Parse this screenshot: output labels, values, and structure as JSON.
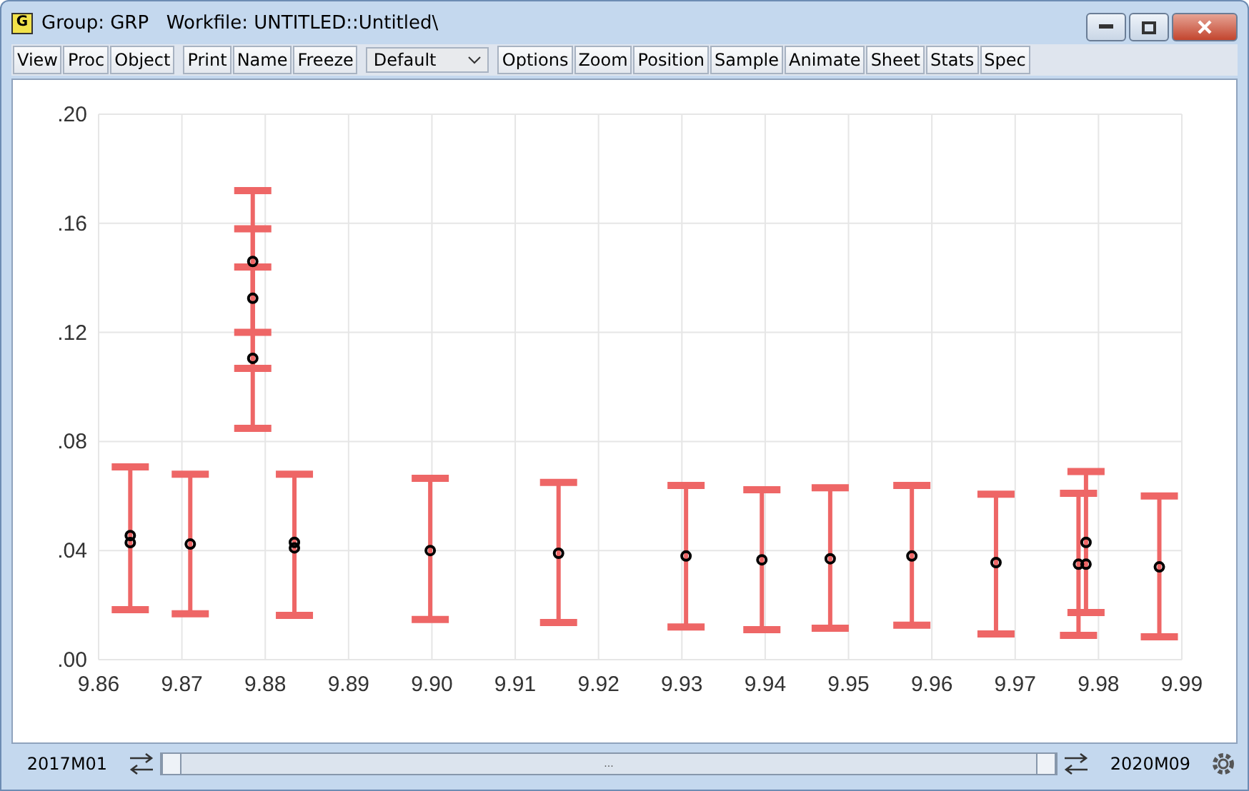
{
  "window": {
    "title": "Group: GRP   Workfile: UNTITLED::Untitled\\",
    "icon": "G"
  },
  "toolbar": {
    "groups": [
      [
        "View",
        "Proc",
        "Object"
      ],
      [
        "Print",
        "Name",
        "Freeze"
      ]
    ],
    "dropdown": {
      "value": "Default"
    },
    "more": [
      "Options",
      "Zoom",
      "Position",
      "Sample",
      "Animate",
      "Sheet",
      "Stats",
      "Spec"
    ]
  },
  "chart": {
    "chart_data": {
      "type": "scatter",
      "grid": true,
      "x": [
        9.8638,
        9.8638,
        9.871,
        9.8785,
        9.8785,
        9.8785,
        9.8835,
        9.8835,
        9.8998,
        9.9152,
        9.9305,
        9.9396,
        9.9478,
        9.9576,
        9.9677,
        9.9776,
        9.9785,
        9.9785,
        9.9873
      ],
      "series": [
        {
          "color": "#000000",
          "values": [
            0.0455,
            0.0429,
            0.0424,
            0.146,
            0.1325,
            0.1105,
            0.043,
            0.041,
            0.04,
            0.039,
            0.038,
            0.0366,
            0.037,
            0.038,
            0.0356,
            0.035,
            0.035,
            0.043,
            0.034
          ],
          "errors": [
            [
              0.0183,
              0.0707
            ],
            null,
            [
              0.0168,
              0.068
            ],
            [
              0.12,
              0.172
            ],
            [
              0.1068,
              0.158
            ],
            [
              0.0848,
              0.144
            ],
            [
              0.0162,
              0.068
            ],
            null,
            [
              0.0147,
              0.0665
            ],
            [
              0.0136,
              0.065
            ],
            [
              0.012,
              0.0639
            ],
            [
              0.011,
              0.0623
            ],
            [
              0.0115,
              0.063
            ],
            [
              0.0126,
              0.0639
            ],
            [
              0.0094,
              0.0607
            ],
            [
              0.0089,
              0.061
            ],
            null,
            [
              0.0173,
              0.069
            ],
            [
              0.0084,
              0.06
            ]
          ]
        }
      ],
      "xlim": [
        9.86,
        9.99
      ],
      "ylim": [
        0,
        0.2
      ],
      "xticks": [
        {
          "value": 9.86,
          "label": "9.86"
        },
        {
          "value": 9.87,
          "label": "9.87"
        },
        {
          "value": 9.88,
          "label": "9.88"
        },
        {
          "value": 9.89,
          "label": "9.89"
        },
        {
          "value": 9.9,
          "label": "9.90"
        },
        {
          "value": 9.91,
          "label": "9.91"
        },
        {
          "value": 9.92,
          "label": "9.92"
        },
        {
          "value": 9.93,
          "label": "9.93"
        },
        {
          "value": 9.94,
          "label": "9.94"
        },
        {
          "value": 9.95,
          "label": "9.95"
        },
        {
          "value": 9.96,
          "label": "9.96"
        },
        {
          "value": 9.97,
          "label": "9.97"
        },
        {
          "value": 9.98,
          "label": "9.98"
        },
        {
          "value": 9.99,
          "label": "9.99"
        }
      ],
      "yticks": [
        {
          "value": 0,
          "label": ".00"
        },
        {
          "value": 0.04,
          "label": ".04"
        },
        {
          "value": 0.08,
          "label": ".08"
        },
        {
          "value": 0.12,
          "label": ".12"
        },
        {
          "value": 0.16,
          "label": ".16"
        },
        {
          "value": 0.2,
          "label": ".20"
        }
      ]
    }
  },
  "status_bar": {
    "start": "2017M01",
    "end": "2020M09",
    "slider_label": "...",
    "level": 1
  }
}
